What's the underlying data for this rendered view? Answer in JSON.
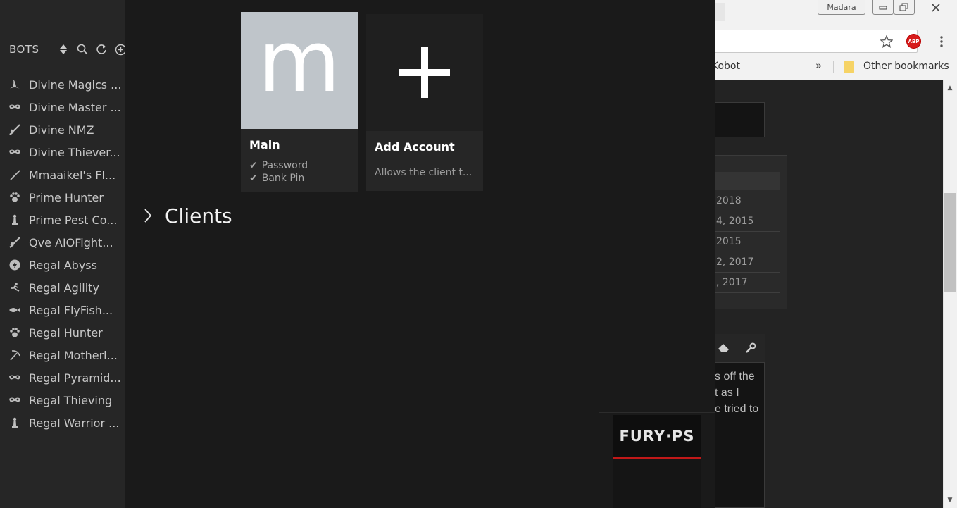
{
  "sidebar": {
    "title": "BOTS",
    "header_icons": [
      "sort-icon",
      "search-icon",
      "refresh-icon",
      "add-circle-icon"
    ],
    "items": [
      {
        "label": "Divine Magics ...",
        "icon": "wizard-hat-icon"
      },
      {
        "label": "Divine Master ...",
        "icon": "mask-icon"
      },
      {
        "label": "Divine NMZ",
        "icon": "sword-icon"
      },
      {
        "label": "Divine Thiever...",
        "icon": "mask-icon"
      },
      {
        "label": "Mmaaikel's Fl...",
        "icon": "wand-icon"
      },
      {
        "label": "Prime Hunter",
        "icon": "paw-icon"
      },
      {
        "label": "Prime Pest Co...",
        "icon": "chess-pawn-icon"
      },
      {
        "label": "Qve AIOFight...",
        "icon": "sword-icon"
      },
      {
        "label": "Regal Abyss",
        "icon": "rune-icon"
      },
      {
        "label": "Regal Agility",
        "icon": "runner-icon"
      },
      {
        "label": "Regal FlyFish...",
        "icon": "fish-icon"
      },
      {
        "label": "Regal Hunter",
        "icon": "paw-icon"
      },
      {
        "label": "Regal Motherl...",
        "icon": "pickaxe-icon"
      },
      {
        "label": "Regal Pyramid...",
        "icon": "mask-icon"
      },
      {
        "label": "Regal Thieving",
        "icon": "mask-icon"
      },
      {
        "label": "Regal Warrior ...",
        "icon": "chess-pawn-icon"
      }
    ]
  },
  "accounts": {
    "main": {
      "letter": "m",
      "name": "Main",
      "features": [
        "Password",
        "Bank Pin"
      ],
      "tick": "✔"
    },
    "add": {
      "symbol": "+",
      "name": "Add Account",
      "description": "Allows the client t..."
    }
  },
  "clients": {
    "label": "Clients"
  },
  "ad": {
    "logo": "FURY·PS"
  },
  "browser": {
    "profile": "Madara",
    "bookmarks": {
      "partial": "Kobot",
      "more": "»",
      "other": "Other bookmarks"
    },
    "abp": "ABP",
    "dates": [
      "2018",
      "4, 2015",
      "2015",
      "2, 2017",
      ", 2017"
    ],
    "post_text": [
      "s off the",
      "t as I",
      "e tried to"
    ]
  },
  "colors": {
    "sidebar_bg": "#262626",
    "main_bg": "#1a1a1a",
    "card_bg": "#262626",
    "avatar_bg": "#bfc5ca",
    "ad_accent": "#c01818"
  }
}
